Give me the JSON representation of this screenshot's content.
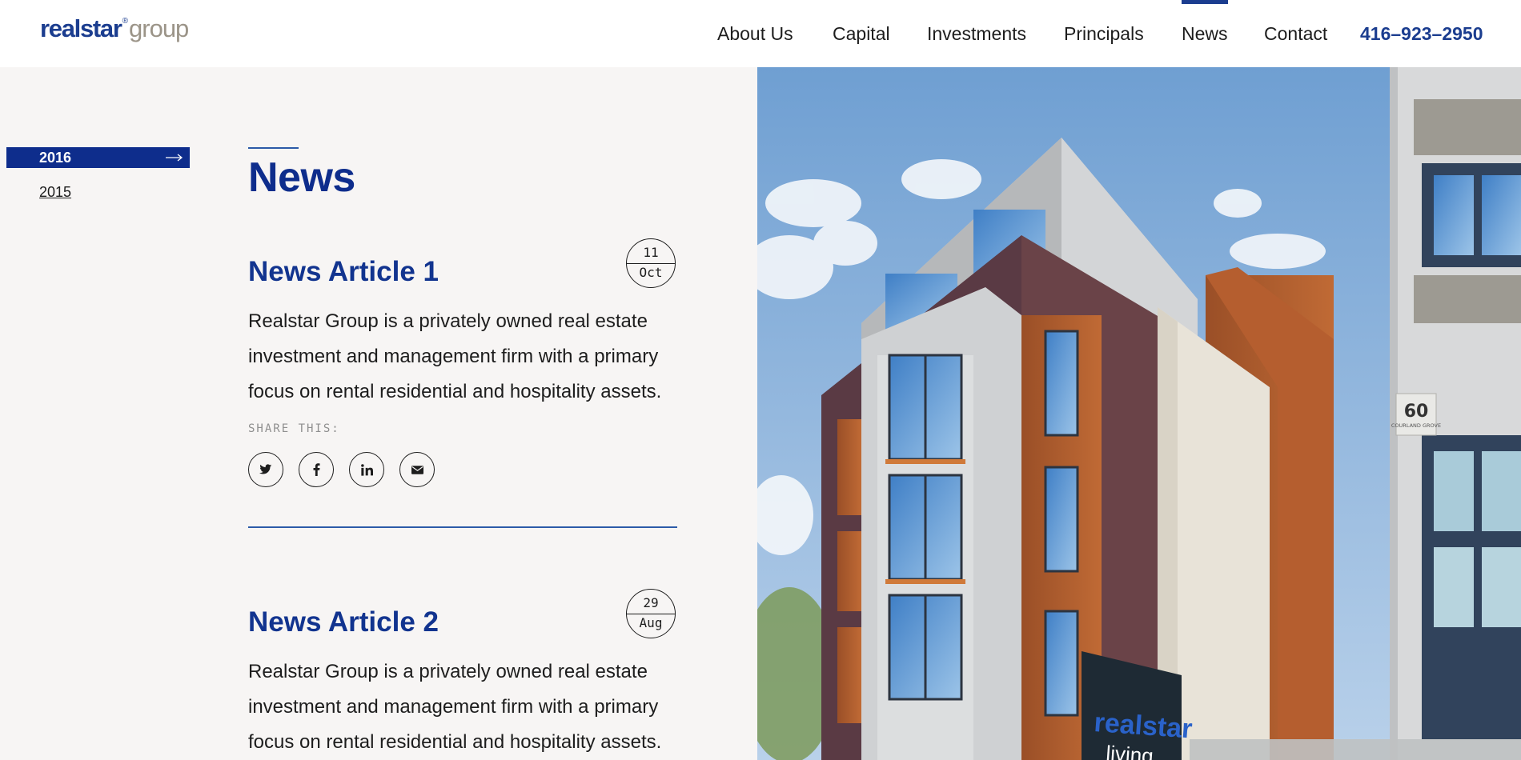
{
  "header": {
    "logo": {
      "main": "realstar",
      "registered": "®",
      "sub": "group"
    },
    "nav": [
      {
        "label": "About Us",
        "active": false
      },
      {
        "label": "Capital",
        "active": false
      },
      {
        "label": "Investments",
        "active": false
      },
      {
        "label": "Principals",
        "active": false
      },
      {
        "label": "News",
        "active": true
      },
      {
        "label": "Contact",
        "active": false
      }
    ],
    "phone": "416–923–2950"
  },
  "sidebar": {
    "years": [
      {
        "label": "2016",
        "active": true
      },
      {
        "label": "2015",
        "active": false
      }
    ]
  },
  "main": {
    "title": "News",
    "articles": [
      {
        "title": "News Article 1",
        "day": "11",
        "month": "Oct",
        "body": "Realstar Group is a privately owned real estate investment and management firm with a primary focus on rental residential and hospitality assets.",
        "share_label": "SHARE THIS:"
      },
      {
        "title": "News Article 2",
        "day": "29",
        "month": "Aug",
        "body": "Realstar Group is a privately owned real estate investment and management firm with a primary focus on rental residential and hospitality assets."
      }
    ]
  },
  "share_icons": [
    "twitter-icon",
    "facebook-icon",
    "linkedin-icon",
    "email-icon"
  ],
  "photo": {
    "address_number": "60",
    "address_street": "COURLAND GROVE",
    "sign_brand": "realstar",
    "sign_sub": "living"
  },
  "colors": {
    "brand_blue": "#0e2d8c",
    "accent_blue": "#2c5aa8",
    "logo_gray": "#9b9488",
    "panel_bg": "#f7f5f4"
  }
}
